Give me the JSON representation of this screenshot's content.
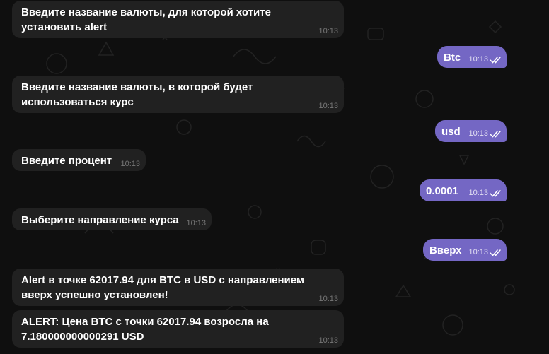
{
  "messages": [
    {
      "dir": "in",
      "text": "Введите название валюты, для которой хотите установить alert",
      "time": "10:13"
    },
    {
      "dir": "out",
      "text": "Btc",
      "time": "10:13"
    },
    {
      "dir": "in",
      "text": "Введите название валюты, в которой будет использоваться курс",
      "time": "10:13"
    },
    {
      "dir": "out",
      "text": "usd",
      "time": "10:13"
    },
    {
      "dir": "in",
      "text": "Введите процент",
      "time": "10:13"
    },
    {
      "dir": "out",
      "text": "0.0001",
      "time": "10:13"
    },
    {
      "dir": "in",
      "text": "Выберите направление курса",
      "time": "10:13"
    },
    {
      "dir": "out",
      "text": "Вверх",
      "time": "10:13"
    },
    {
      "dir": "in",
      "text": "Alert в точке 62017.94 для BTC в USD с направлением вверх успешно установлен!",
      "time": "10:13"
    },
    {
      "dir": "in",
      "text": "ALERT: Цена BTC с точки 62017.94 возросла на 7.180000000000291 USD",
      "time": "10:13"
    }
  ],
  "colors": {
    "background": "#0f0f0f",
    "incoming_bubble": "#212121",
    "outgoing_bubble": "#7467c4"
  }
}
